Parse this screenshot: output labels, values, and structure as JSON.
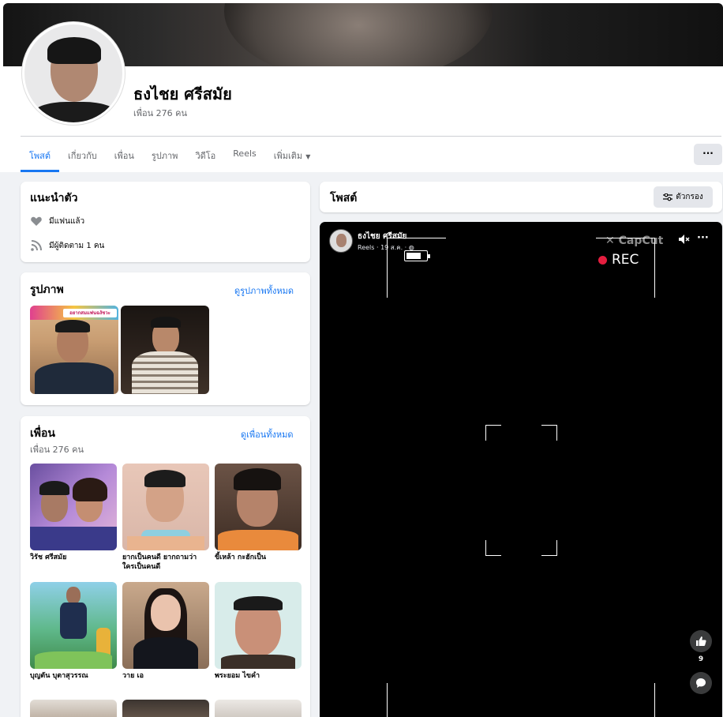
{
  "profile": {
    "name": "ธงไชย ศรีสมัย",
    "friend_count": "เพื่อน 276 คน"
  },
  "tabs": [
    {
      "label": "โพสต์",
      "active": true
    },
    {
      "label": "เกี่ยวกับ"
    },
    {
      "label": "เพื่อน"
    },
    {
      "label": "รูปภาพ"
    },
    {
      "label": "วิดีโอ"
    },
    {
      "label": "Reels"
    },
    {
      "label": "เพิ่มเติม"
    }
  ],
  "more_button": "···",
  "intro": {
    "title": "แนะนำตัว",
    "relationship": "มีแฟนแล้ว",
    "followers": "มีผู้ติดตาม 1 คน",
    "heart_icon": "heart-icon",
    "rss_icon": "rss-icon"
  },
  "photos": {
    "title": "รูปภาพ",
    "see_all": "ดูรูปภาพทั้งหมด",
    "banner_text": "อยากสมแฟนฉงัชวะ"
  },
  "friends": {
    "title": "เพื่อน",
    "count": "เพื่อน 276 คน",
    "see_all": "ดูเพื่อนทั้งหมด",
    "items": [
      {
        "name": "วิรัช ศรีสมัย"
      },
      {
        "name": "ยากเป็นคนดี ยากถามว่า ใครเป็นคนดี"
      },
      {
        "name": "ขี้เหล้า กะฮักเป็น"
      },
      {
        "name": "บุญตัน บุตาสุวรรณ"
      },
      {
        "name": "วาย เอ"
      },
      {
        "name": "พระยอม ไขคำ"
      }
    ]
  },
  "posts_header": {
    "title": "โพสต์",
    "filter": "ตัวกรอง"
  },
  "post": {
    "author": "ธงไชย ศรีสมัย",
    "meta": "Reels · 19 ส.ค. ·",
    "watermark": "CapCut",
    "rec_label": "REC",
    "like_count": "9"
  },
  "colors": {
    "accent": "#1877f2",
    "background": "#f0f2f5",
    "rec": "#e41e3f"
  }
}
